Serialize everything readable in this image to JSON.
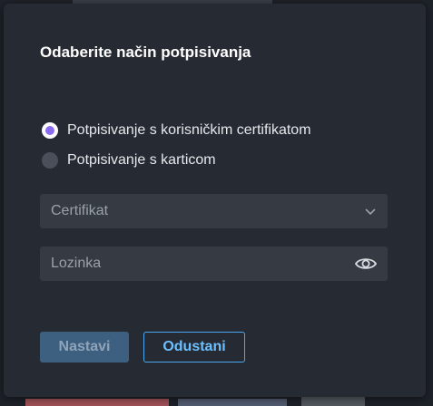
{
  "dialog": {
    "title": "Odaberite način potpisivanja",
    "options": [
      {
        "label": "Potpisivanje s korisničkim certifikatom",
        "selected": true
      },
      {
        "label": "Potpisivanje s karticom",
        "selected": false
      }
    ],
    "certificate_select": {
      "placeholder": "Certifikat",
      "icon": "chevron-down-icon"
    },
    "password_input": {
      "placeholder": "Lozinka",
      "icon": "eye-icon"
    },
    "buttons": {
      "continue": "Nastavi",
      "cancel": "Odustani"
    }
  },
  "colors": {
    "accent_radio": "#8b6cf0",
    "primary_button": "#3d5f80",
    "cancel_border": "#4aa8f0"
  }
}
